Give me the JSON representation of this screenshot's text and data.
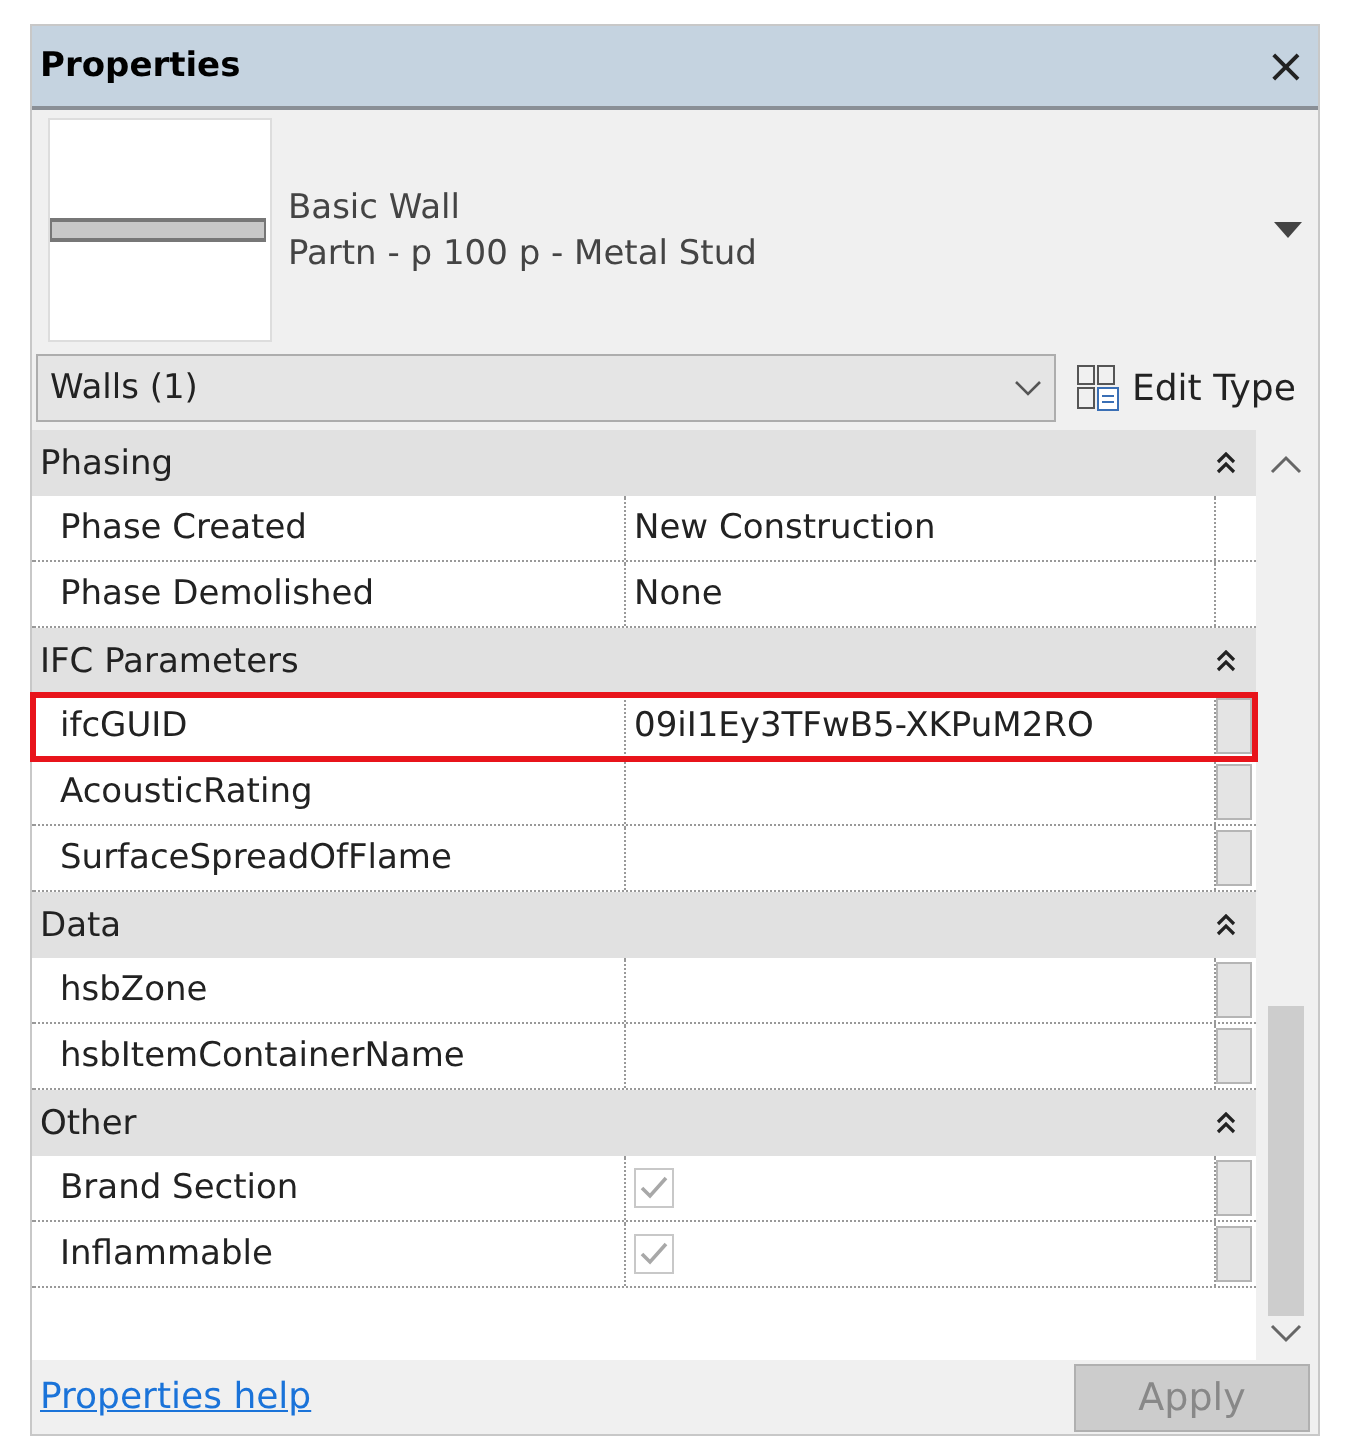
{
  "window": {
    "title": "Properties",
    "close": "×"
  },
  "type_selector": {
    "family": "Basic Wall",
    "type": "Partn - p 100 p - Metal Stud"
  },
  "filter": {
    "value": "Walls (1)"
  },
  "edit_type": {
    "label": "Edit Type"
  },
  "sections": [
    {
      "title": "Phasing",
      "expanded": true,
      "rows": [
        {
          "name": "Phase Created",
          "kind": "text",
          "value": "New Construction",
          "has_button": false,
          "highlighted": false
        },
        {
          "name": "Phase Demolished",
          "kind": "text",
          "value": "None",
          "has_button": false,
          "highlighted": false
        }
      ]
    },
    {
      "title": "IFC Parameters",
      "expanded": true,
      "rows": [
        {
          "name": "ifcGUID",
          "kind": "text",
          "value": "09iI1Ey3TFwB5-XKPuM2RO",
          "has_button": true,
          "highlighted": true
        },
        {
          "name": "AcousticRating",
          "kind": "text",
          "has_button": true,
          "highlighted": false
        },
        {
          "name": "SurfaceSpreadOfFlame",
          "kind": "text",
          "has_button": true,
          "highlighted": false
        }
      ]
    },
    {
      "title": "Data",
      "expanded": true,
      "rows": [
        {
          "name": "hsbZone",
          "kind": "text",
          "has_button": true,
          "highlighted": false
        },
        {
          "name": "hsbItemContainerName",
          "kind": "text",
          "has_button": true,
          "highlighted": false
        }
      ]
    },
    {
      "title": "Other",
      "expanded": true,
      "rows": [
        {
          "name": "Brand Section",
          "kind": "checkbox",
          "checked": true,
          "disabled": true,
          "has_button": true,
          "highlighted": false
        },
        {
          "name": "Inflammable",
          "kind": "checkbox",
          "checked": true,
          "disabled": true,
          "has_button": true,
          "highlighted": false
        }
      ]
    }
  ],
  "footer": {
    "help_link": "Properties help",
    "apply": {
      "label": "Apply",
      "disabled": true
    }
  }
}
